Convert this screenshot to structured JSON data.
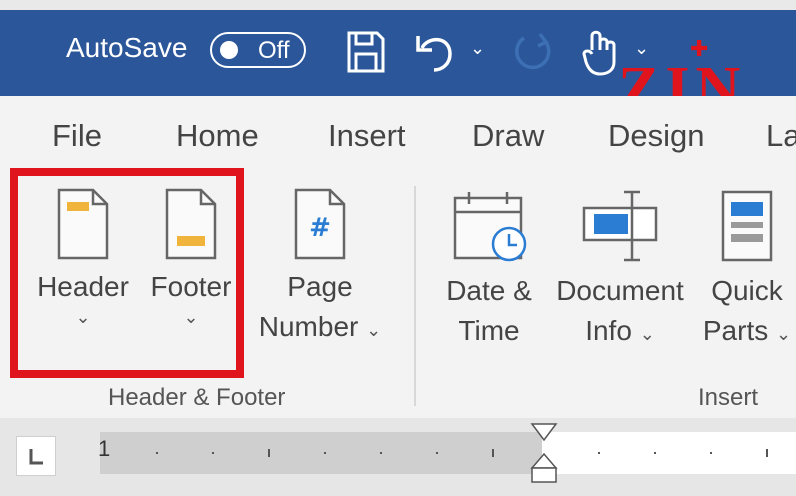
{
  "title_bar": {
    "autosave_label": "AutoSave",
    "autosave_state": "Off"
  },
  "logo": {
    "text": "ZIN"
  },
  "tabs": [
    "File",
    "Home",
    "Insert",
    "Draw",
    "Design",
    "La"
  ],
  "ribbon": {
    "commands": {
      "header": "Header",
      "footer": "Footer",
      "page_number_line1": "Page",
      "page_number_line2": "Number",
      "date_time_line1": "Date &",
      "date_time_line2": "Time",
      "document_info_line1": "Document",
      "document_info_line2": "Info",
      "quick_parts_line1": "Quick",
      "quick_parts_line2": "Parts"
    },
    "groups": {
      "header_footer": "Header & Footer",
      "insert": "Insert"
    }
  },
  "ruler": {
    "start_number": "1"
  },
  "colors": {
    "title_bar": "#2b579a",
    "highlight": "#e0141c",
    "icon_accent": "#f0b43c",
    "icon_blue": "#2b7cd3"
  }
}
